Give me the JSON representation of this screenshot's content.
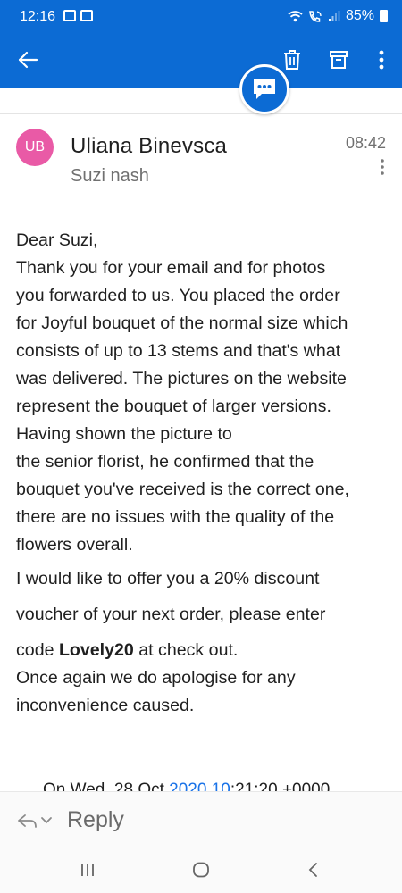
{
  "status_bar": {
    "time": "12:16",
    "battery": "85%"
  },
  "toolbar": {
    "icons": [
      "back-arrow-icon",
      "trash-icon",
      "archive-icon",
      "more-vertical-icon"
    ],
    "fab_icon": "chat-bubble-icon",
    "accent_color": "#0c6bd4"
  },
  "message": {
    "avatar_initials": "UB",
    "avatar_color": "#e95aa6",
    "sender": "Uliana Binevsca",
    "recipient": "Suzi nash",
    "time": "08:42",
    "greeting": "Dear Suzi,",
    "lines": [
      "Thank you for your email and for photos",
      "you forwarded to us. You placed the order",
      "for Joyful bouquet of the normal size which",
      "consists of up to 13 stems and that's what",
      "was delivered. The pictures on the website",
      "represent the bouquet of larger versions.",
      "Having shown the picture to",
      "the senior florist, he confirmed that the",
      "bouquet you've received is the correct one,",
      "there are no issues with the quality of the",
      "flowers overall."
    ],
    "offer_line1": "I would like to offer you a 20% discount",
    "offer_line2": "voucher of your next order, please enter",
    "code_prefix": "code ",
    "code": "Lovely20",
    "code_suffix": " at check out.",
    "closing_line1": "Once again we do apologise for any",
    "closing_line2": "inconvenience caused.",
    "quoted_header_prefix": "On Wed, 28 Oct ",
    "quoted_header_link": "2020 10",
    "quoted_header_suffix": ":21:20 +0000"
  },
  "reply": {
    "label": "Reply"
  }
}
